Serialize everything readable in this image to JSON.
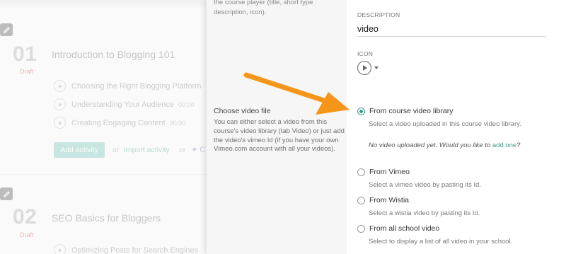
{
  "course": {
    "sections": [
      {
        "number": "01",
        "status": "Draft",
        "title": "Introduction to Blogging 101",
        "lessons": [
          {
            "title": "Choosing the Right Blogging Platform",
            "duration": ""
          },
          {
            "title": "Understanding Your Audience",
            "duration": "00:00"
          },
          {
            "title": "Creating Engaging Content",
            "duration": "00:00"
          }
        ],
        "add_activity_label": "Add activity",
        "or_label": "or",
        "import_activity_label": "Import activity",
        "ai_label": "C"
      },
      {
        "number": "02",
        "status": "Draft",
        "title": "SEO Basics for Bloggers",
        "lessons": [
          {
            "title": "Optimizing Posts for Search Engines",
            "duration": ""
          }
        ]
      }
    ]
  },
  "panel": {
    "top_help": "the course player (title, short type description, icon).",
    "choose_title": "Choose video file",
    "choose_help": "You can either select a video from this course's video library (tab Video) or just add the video's vimeo Id (if you have your own Vimeo.com account with all your videos).",
    "description_label": "DESCRIPTION",
    "description_value": "video",
    "icon_label": "ICON",
    "icon_name": "play-circle-icon",
    "options": [
      {
        "label": "From course video library",
        "help": "Select a video uploaded in this course video library.",
        "selected": true
      },
      {
        "label": "From Vimeo",
        "help": "Select a vimeo video by pasting its Id.",
        "selected": false
      },
      {
        "label": "From Wistia",
        "help": "Select a wistia video by pasting its Id.",
        "selected": false
      },
      {
        "label": "From all school video",
        "help": "Select to display a list of all video in your school.",
        "selected": false
      }
    ],
    "no_video_text": "No video uploaded yet. Would you like to",
    "add_one_link": "add one",
    "no_video_suffix": "?"
  },
  "colors": {
    "accent": "#3a9c8c",
    "arrow": "#f5961a",
    "draft": "#e08080"
  }
}
